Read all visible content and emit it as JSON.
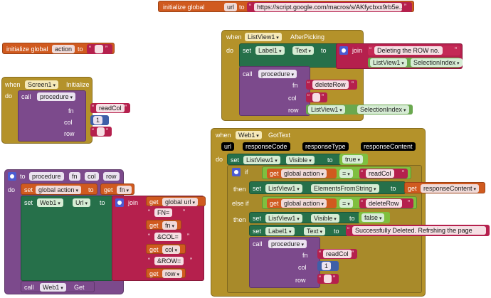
{
  "colors": {
    "global_var": "#d05a1f",
    "text": "#b5204d",
    "component": "#26704a",
    "procedure": "#7c4a8c",
    "event": "#b4922a",
    "logic": "#7fbf3f"
  },
  "b1": {
    "kw": "initialize global",
    "name": "url",
    "to": "to",
    "value": "https://script.google.com/macros/s/AKfycbxx9rb5e..."
  },
  "b2": {
    "kw": "initialize global",
    "name": "action",
    "to": "to"
  },
  "b3": {
    "when": "when",
    "comp": "Screen1",
    "event": "Initialize",
    "do": "do",
    "call": "call",
    "proc": "procedure",
    "fn": "fn",
    "fnv": "readCol",
    "col": "col",
    "colv": "1",
    "row": "row"
  },
  "b4": {
    "when": "when",
    "comp": "ListView1",
    "event": "AfterPicking",
    "do": "do",
    "set": "set",
    "l1": "Label1",
    "text": "Text",
    "to": "to",
    "join": "join",
    "str": "Deleting the ROW no.",
    "lv": "ListView1",
    "si": "SelectionIndex",
    "call": "call",
    "proc": "procedure",
    "fn": "fn",
    "fnv": "deleteRow",
    "col": "col",
    "row": "row",
    "lv2": "ListView1",
    "si2": "SelectionIndex"
  },
  "b5": {
    "to": "to",
    "proc": "procedure",
    "p1": "fn",
    "p2": "col",
    "p3": "row",
    "do": "do",
    "set": "set",
    "gv": "global action",
    "to2": "to",
    "get": "get",
    "fn": "fn",
    "set2": "set",
    "web": "Web1",
    "url": "Url",
    "to3": "to",
    "join": "join",
    "get_url": "get",
    "gurl": "global url",
    "s1": "FN=",
    "get_fn": "get",
    "vfn": "fn",
    "s2": "&COL=",
    "get_col": "get",
    "vcol": "col",
    "s3": "&ROW=",
    "get_row": "get",
    "vrow": "row",
    "call": "call",
    "web2": "Web1",
    "gt": "Get"
  },
  "b6": {
    "when": "when",
    "comp": "Web1",
    "event": "GotText",
    "p_url": "url",
    "p_rc": "responseCode",
    "p_rt": "responseType",
    "p_rcont": "responseContent",
    "do": "do",
    "set": "set",
    "lv": "ListView1",
    "vis": "Visible",
    "to": "to",
    "true": "true",
    "if": "if",
    "get": "get",
    "ga": "global action",
    "eq": "=",
    "read": "readCol",
    "then": "then",
    "set2": "set",
    "lv2": "ListView1",
    "efs": "ElementsFromString",
    "to2": "to",
    "get2": "get",
    "rcont": "responseContent",
    "elseif": "else if",
    "get3": "get",
    "ga2": "global action",
    "eq2": "=",
    "del": "deleteRow",
    "then2": "then",
    "set3": "set",
    "lv3": "ListView1",
    "vis2": "Visible",
    "to3": "to",
    "false": "false",
    "set4": "set",
    "l1": "Label1",
    "text": "Text",
    "to4": "to",
    "succ": "Successfully Deleted. Refrshing the page",
    "call": "call",
    "proc": "procedure",
    "fn": "fn",
    "fnv": "readCol",
    "col": "col",
    "colv": "1",
    "row": "row"
  }
}
